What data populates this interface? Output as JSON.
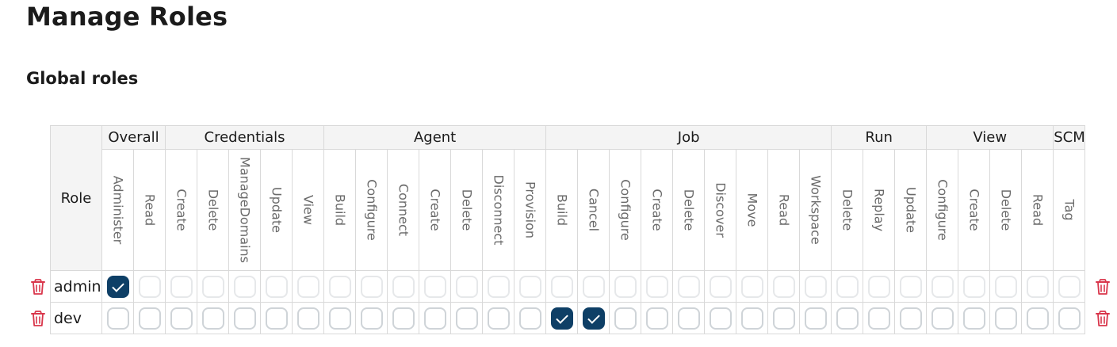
{
  "page": {
    "title": "Manage Roles",
    "section_title": "Global roles"
  },
  "table": {
    "role_header": "Role",
    "groups": [
      {
        "name": "Overall",
        "permissions": [
          "Administer",
          "Read"
        ]
      },
      {
        "name": "Credentials",
        "permissions": [
          "Create",
          "Delete",
          "ManageDomains",
          "Update",
          "View"
        ]
      },
      {
        "name": "Agent",
        "permissions": [
          "Build",
          "Configure",
          "Connect",
          "Create",
          "Delete",
          "Disconnect",
          "Provision"
        ]
      },
      {
        "name": "Job",
        "permissions": [
          "Build",
          "Cancel",
          "Configure",
          "Create",
          "Delete",
          "Discover",
          "Move",
          "Read",
          "Workspace"
        ]
      },
      {
        "name": "Run",
        "permissions": [
          "Delete",
          "Replay",
          "Update"
        ]
      },
      {
        "name": "View",
        "permissions": [
          "Configure",
          "Create",
          "Delete",
          "Read"
        ]
      },
      {
        "name": "SCM",
        "permissions": [
          "Tag"
        ]
      }
    ],
    "roles": [
      {
        "name": "admin",
        "checked": [
          0
        ]
      },
      {
        "name": "dev",
        "checked": [
          14,
          15
        ]
      }
    ]
  },
  "colors": {
    "checked_fill": "#0e3f66",
    "delete_icon": "#d9364b",
    "header_bg": "#f4f4f4"
  },
  "icons": {
    "delete": "trash-icon"
  }
}
